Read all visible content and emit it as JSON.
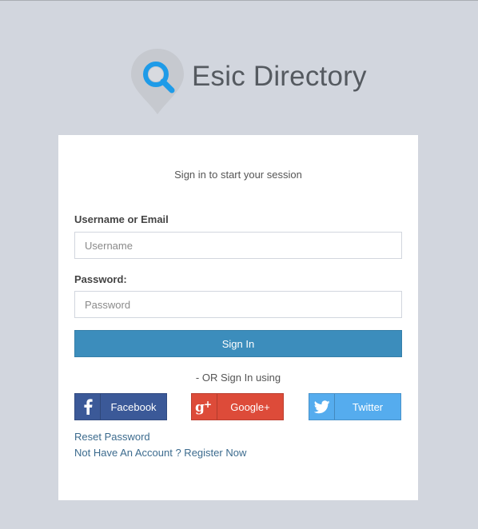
{
  "logo": {
    "title": "Esic Directory",
    "icon": "map-pin-search-icon"
  },
  "login": {
    "message": "Sign in to start your session",
    "username_label": "Username or Email",
    "username_placeholder": "Username",
    "username_value": "",
    "password_label": "Password:",
    "password_placeholder": "Password",
    "password_value": "",
    "signin_label": "Sign In",
    "or_text": "- OR Sign In using",
    "social": {
      "facebook": "Facebook",
      "google": "Google+",
      "twitter": "Twitter"
    },
    "reset_link": "Reset Password",
    "register_link": "Not Have An Account ? Register Now"
  },
  "colors": {
    "background": "#d2d6de",
    "primary": "#3c8dbc",
    "facebook": "#3b5998",
    "google": "#dd4b39",
    "twitter": "#55acee",
    "logo_accent": "#1e9be8"
  }
}
